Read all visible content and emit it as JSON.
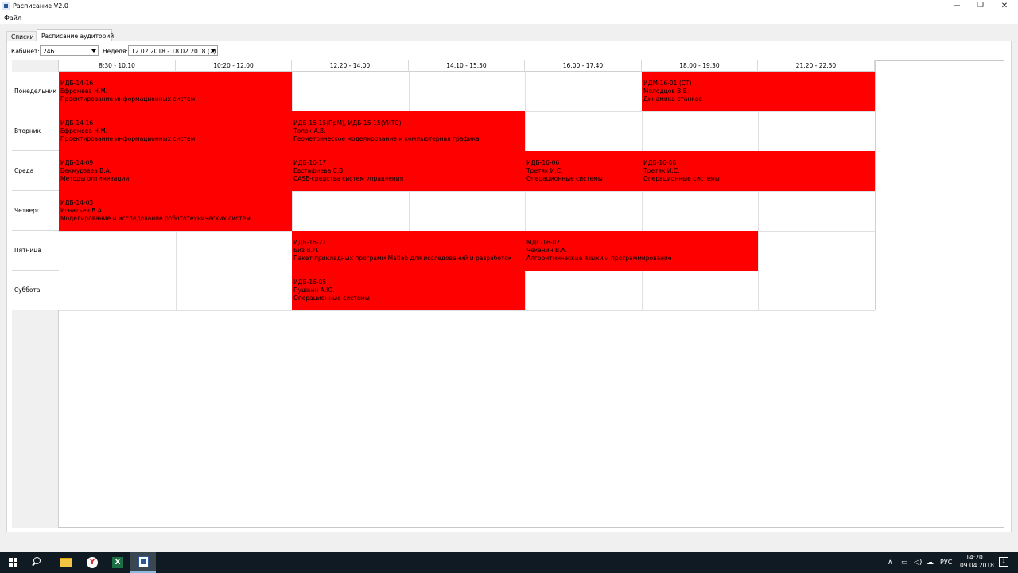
{
  "window": {
    "title": "Расписание V2.0",
    "minimize_glyph": "—",
    "maximize_glyph": "❐",
    "close_glyph": "✕"
  },
  "menu": {
    "file": "Файл"
  },
  "tabs": [
    {
      "label": "Списки",
      "active": false
    },
    {
      "label": "Расписание аудиторий",
      "active": true
    }
  ],
  "filters": {
    "room_label": "Кабинет:",
    "room_value": "246",
    "week_label": "Неделя:",
    "week_value": "12.02.2018 - 18.02.2018 (2)"
  },
  "time_slots": [
    "8:30 - 10.10",
    "10:20 - 12.00",
    "12.20 - 14.00",
    "14.10 - 15.50",
    "16.00 - 17.40",
    "18.00 - 19.30",
    "21.20 - 22.50"
  ],
  "days": [
    "Понедельник",
    "Вторник",
    "Среда",
    "Четверг",
    "Пятница",
    "Суббота"
  ],
  "lessons": [
    {
      "group": "ИДБ-14-16",
      "teacher": "Ефромеев Н.М.",
      "subject": "Проектирование информационных систем"
    },
    {
      "group": "ИДМ-16-01 (СТ)",
      "teacher": "Молодцов В.В.",
      "subject": "Динамика станков"
    },
    {
      "group": "ИДБ-14-16",
      "teacher": "Ефромеев Н.М.",
      "subject": "Проектирование информационных систем"
    },
    {
      "group": "ИДБ-15-15(ПрМ), ИДБ-15-15(УИТС)",
      "teacher": "Толок А.В.",
      "subject": "Геометрическое моделирование и компьютерная графика"
    },
    {
      "group": "ИДБ-14-09",
      "teacher": "Бекмурзаев В.А.",
      "subject": "Методы оптимизации"
    },
    {
      "group": "ИДБ-16-17",
      "teacher": "Евстафиева С.В.",
      "subject": "CASE-средства систем управления"
    },
    {
      "group": "ИДБ-16-06",
      "teacher": "Третяк И.С.",
      "subject": "Операционные системы"
    },
    {
      "group": "ИДБ-16-06",
      "teacher": "Третяк И.С.",
      "subject": "Операционные системы"
    },
    {
      "group": "ИДБ-14-03",
      "teacher": "Игнатьев В.А.",
      "subject": "Моделирование и исследование робототехнических систем"
    },
    {
      "group": "ИДБ-16-21",
      "teacher": "Биз В.Л.",
      "subject": "Пакет прикладных программ Matlab для исследований и разработок"
    },
    {
      "group": "МДС-16-02",
      "teacher": "Чеканин В.А.",
      "subject": "Алгоритмические языки и программирование"
    },
    {
      "group": "ИДБ-16-05",
      "teacher": "Пушкин А.Ю.",
      "subject": "Операционные системы"
    }
  ],
  "colors": {
    "lesson_fill": "#ff0000",
    "taskbar": "#101a22"
  },
  "taskbar": {
    "icons": [
      "windows-start-icon",
      "search-icon",
      "file-explorer-icon",
      "yandex-browser-icon",
      "excel-icon",
      "schedule-app-icon"
    ],
    "yandex_glyph": "Y",
    "excel_glyph": "X",
    "tray_chevron": "∧",
    "tray_network": "▭",
    "tray_volume": "◁)",
    "tray_cloud": "☁",
    "language": "РУС",
    "time": "14:20",
    "date": "09.04.2018",
    "notifications": "1"
  }
}
